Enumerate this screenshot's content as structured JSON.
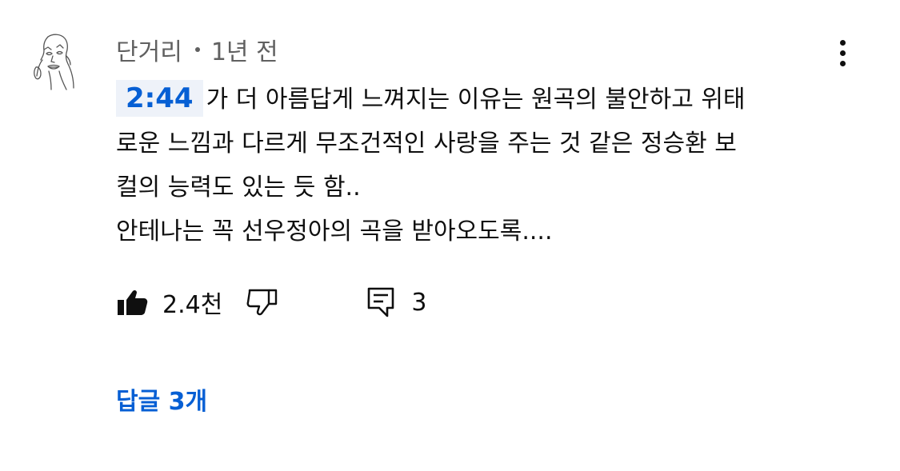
{
  "comment": {
    "author": "단거리",
    "time": "1년 전",
    "timestamp_link": "2:44",
    "text_line1_rest": "가 더 아름답게 느껴지는 이유는 원곡의 불안하고 위태",
    "text_line2": "로운 느낌과 다르게 무조건적인 사랑을 주는 것 같은 정승환 보",
    "text_line3": "컬의 능력도 있는 듯 함..",
    "text_line4": "안테나는 꼭 선우정아의 곡을 받아오도록...."
  },
  "actions": {
    "like_count": "2.4천",
    "reply_count": "3",
    "like_icon": "thumbs-up-filled-icon",
    "dislike_icon": "thumbs-down-outline-icon",
    "reply_icon": "comment-icon",
    "more_icon": "more-vertical-icon"
  },
  "replies": {
    "toggle_label": "답글 3개"
  },
  "colors": {
    "link_blue": "#065fd4",
    "secondary_text": "#606060",
    "timestamp_bg": "#eef2f9"
  }
}
